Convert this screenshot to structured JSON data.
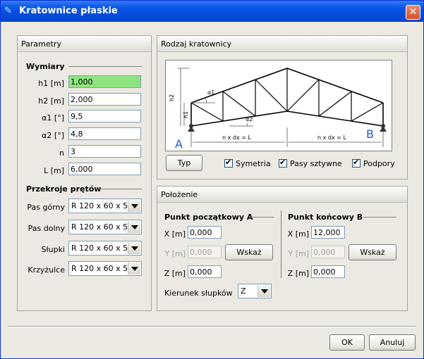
{
  "window": {
    "title": "Kratownice płaskie",
    "close_label": "✕"
  },
  "params": {
    "header": "Parametry",
    "dims_title": "Wymiary",
    "dims": [
      {
        "label": "h1 [m]",
        "value": "1,000"
      },
      {
        "label": "h2 [m]",
        "value": "2,000"
      },
      {
        "label": "α1 [°]",
        "value": "9,5"
      },
      {
        "label": "α2 [°]",
        "value": "4,8"
      },
      {
        "label": "n",
        "value": "3"
      },
      {
        "label": "L [m]",
        "value": "6,000"
      }
    ],
    "sections_title": "Przekroje prętów",
    "sections": [
      {
        "label": "Pas górny",
        "value": "R 120 x 60 x 5"
      },
      {
        "label": "Pas dolny",
        "value": "R 120 x 60 x 5"
      },
      {
        "label": "Słupki",
        "value": "R 120 x 60 x 5"
      },
      {
        "label": "Krzyżulce",
        "value": "R 120 x 60 x 5"
      }
    ]
  },
  "truss": {
    "header": "Rodzaj kratownicy",
    "type_button": "Typ",
    "diagram": {
      "h2": "h2",
      "h1": "h1",
      "a1": "α1",
      "a2": "α2",
      "dim_left": "n x dx = L",
      "dim_right": "n x dx = L",
      "point_a": "A",
      "point_b": "B"
    },
    "checkboxes": [
      {
        "label": "Symetria",
        "checked": true
      },
      {
        "label": "Pasy sztywne",
        "checked": true
      },
      {
        "label": "Podpory",
        "checked": true
      }
    ]
  },
  "position": {
    "header": "Położenie",
    "start": {
      "title": "Punkt początkowy A",
      "x_label": "X [m]",
      "x": "0,000",
      "y_label": "Y [m]",
      "y": "0,000",
      "z_label": "Z [m]",
      "z": "0,000",
      "pick": "Wskaż"
    },
    "end": {
      "title": "Punkt końcowy B",
      "x_label": "X [m]",
      "x": "12,000",
      "y_label": "Y [m]",
      "y": "0,000",
      "z_label": "Z [m]",
      "z": "0,000",
      "pick": "Wskaż"
    },
    "direction_label": "Kierunek słupków",
    "direction_value": "Z"
  },
  "footer": {
    "ok": "OK",
    "cancel": "Anuluj"
  }
}
